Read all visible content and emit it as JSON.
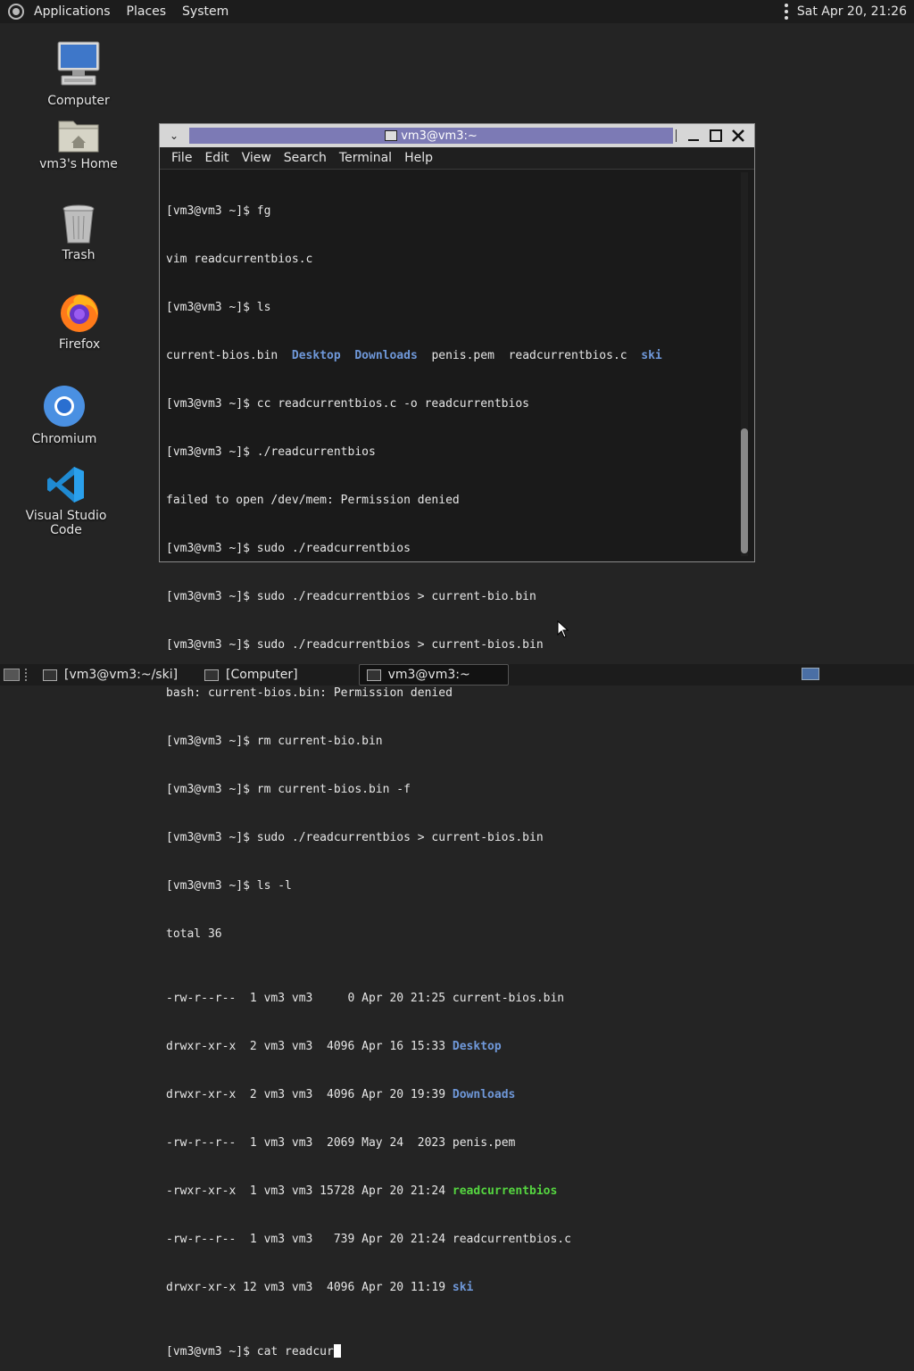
{
  "top_panel": {
    "menus": [
      "Applications",
      "Places",
      "System"
    ],
    "clock": "Sat Apr 20, 21:26"
  },
  "desktop_icons": [
    {
      "label": "Computer",
      "icon": "computer-icon"
    },
    {
      "label": "vm3's Home",
      "icon": "home-folder-icon"
    },
    {
      "label": "Trash",
      "icon": "trash-icon"
    },
    {
      "label": "Firefox",
      "icon": "firefox-icon"
    },
    {
      "label": "Chromium",
      "icon": "chromium-icon"
    },
    {
      "label": "Visual Studio Code",
      "icon": "vscode-icon"
    }
  ],
  "terminal": {
    "title": "vm3@vm3:~",
    "menus": [
      "File",
      "Edit",
      "View",
      "Search",
      "Terminal",
      "Help"
    ],
    "ls_line": {
      "a": "current-bios.bin",
      "b": "Desktop",
      "c": "Downloads",
      "d": "penis.pem",
      "e": "readcurrentbios.c",
      "f": "ski"
    },
    "lines": [
      "[vm3@vm3 ~]$ fg",
      "vim readcurrentbios.c",
      "[vm3@vm3 ~]$ ls",
      "[vm3@vm3 ~]$ cc readcurrentbios.c -o readcurrentbios",
      "[vm3@vm3 ~]$ ./readcurrentbios",
      "failed to open /dev/mem: Permission denied",
      "[vm3@vm3 ~]$ sudo ./readcurrentbios",
      "[vm3@vm3 ~]$ sudo ./readcurrentbios > current-bio.bin",
      "[vm3@vm3 ~]$ sudo ./readcurrentbios > current-bios.bin",
      "bash: current-bios.bin: Permission denied",
      "[vm3@vm3 ~]$ rm current-bio.bin",
      "[vm3@vm3 ~]$ rm current-bios.bin -f",
      "[vm3@vm3 ~]$ sudo ./readcurrentbios > current-bios.bin",
      "[vm3@vm3 ~]$ ls -l",
      "total 36"
    ],
    "listing": [
      {
        "meta": "-rw-r--r--  1 vm3 vm3     0 Apr 20 21:25 ",
        "name": "current-bios.bin",
        "kind": "file"
      },
      {
        "meta": "drwxr-xr-x  2 vm3 vm3  4096 Apr 16 15:33 ",
        "name": "Desktop",
        "kind": "dir"
      },
      {
        "meta": "drwxr-xr-x  2 vm3 vm3  4096 Apr 20 19:39 ",
        "name": "Downloads",
        "kind": "dir"
      },
      {
        "meta": "-rw-r--r--  1 vm3 vm3  2069 May 24  2023 ",
        "name": "penis.pem",
        "kind": "file"
      },
      {
        "meta": "-rwxr-xr-x  1 vm3 vm3 15728 Apr 20 21:24 ",
        "name": "readcurrentbios",
        "kind": "exe"
      },
      {
        "meta": "-rw-r--r--  1 vm3 vm3   739 Apr 20 21:24 ",
        "name": "readcurrentbios.c",
        "kind": "file"
      },
      {
        "meta": "drwxr-xr-x 12 vm3 vm3  4096 Apr 20 11:19 ",
        "name": "ski",
        "kind": "dir"
      }
    ],
    "prompt_line": "[vm3@vm3 ~]$ cat readcur"
  },
  "taskbar": {
    "items": [
      "[vm3@vm3:~/ski]",
      "[Computer]",
      "vm3@vm3:~"
    ]
  },
  "colors": {
    "directory": "#6f98d9",
    "executable": "#55d640",
    "title_highlight": "#7c7ab5"
  }
}
